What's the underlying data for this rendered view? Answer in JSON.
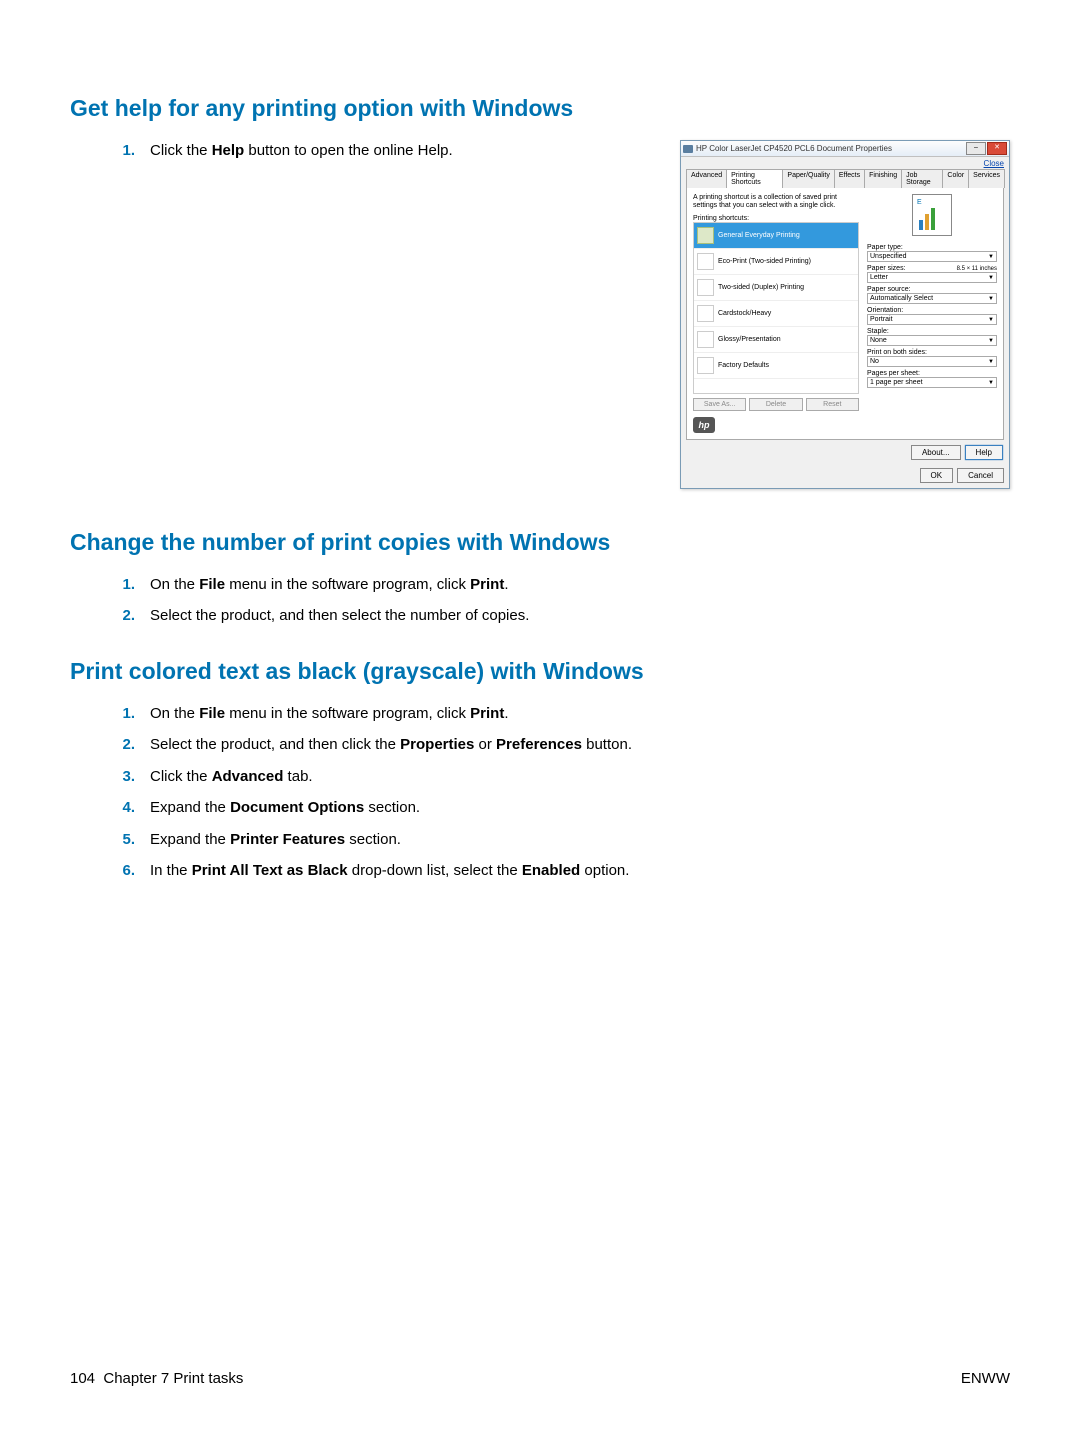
{
  "headings": {
    "h1": "Get help for any printing option with Windows",
    "h2": "Change the number of print copies with Windows",
    "h3": "Print colored text as black (grayscale) with Windows"
  },
  "section1": {
    "step1_num": "1.",
    "step1_a": "Click the ",
    "step1_b": "Help",
    "step1_c": " button to open the online Help."
  },
  "section2": {
    "step1_num": "1.",
    "step1_a": "On the ",
    "step1_b": "File",
    "step1_c": " menu in the software program, click ",
    "step1_d": "Print",
    "step1_e": ".",
    "step2_num": "2.",
    "step2": "Select the product, and then select the number of copies."
  },
  "section3": {
    "s1_num": "1.",
    "s1_a": "On the ",
    "s1_b": "File",
    "s1_c": " menu in the software program, click ",
    "s1_d": "Print",
    "s1_e": ".",
    "s2_num": "2.",
    "s2_a": "Select the product, and then click the ",
    "s2_b": "Properties",
    "s2_c": " or ",
    "s2_d": "Preferences",
    "s2_e": " button.",
    "s3_num": "3.",
    "s3_a": "Click the ",
    "s3_b": "Advanced",
    "s3_c": " tab.",
    "s4_num": "4.",
    "s4_a": "Expand the ",
    "s4_b": "Document Options",
    "s4_c": " section.",
    "s5_num": "5.",
    "s5_a": "Expand the ",
    "s5_b": "Printer Features",
    "s5_c": " section.",
    "s6_num": "6.",
    "s6_a": "In the ",
    "s6_b": "Print All Text as Black",
    "s6_c": " drop-down list, select the ",
    "s6_d": "Enabled",
    "s6_e": " option."
  },
  "footer": {
    "left_page": "104",
    "left_chapter": "Chapter 7   Print tasks",
    "right": "ENWW"
  },
  "dialog": {
    "title": "HP Color LaserJet CP4520 PCL6 Document Properties",
    "close_link": "Close",
    "tabs": [
      "Advanced",
      "Printing Shortcuts",
      "Paper/Quality",
      "Effects",
      "Finishing",
      "Job Storage",
      "Color",
      "Services"
    ],
    "desc": "A printing shortcut is a collection of saved print settings that you can select with a single click.",
    "list_label": "Printing shortcuts:",
    "shortcuts": [
      "General Everyday Printing",
      "Eco-Print (Two-sided Printing)",
      "Two-sided (Duplex) Printing",
      "Cardstock/Heavy",
      "Glossy/Presentation",
      "Factory Defaults"
    ],
    "sbtns": [
      "Save As...",
      "Delete",
      "Reset"
    ],
    "fields": {
      "paper_type_l": "Paper type:",
      "paper_type_v": "Unspecified",
      "paper_size_l": "Paper sizes:",
      "paper_size_note": "8.5 × 11 inches",
      "paper_size_v": "Letter",
      "paper_src_l": "Paper source:",
      "paper_src_v": "Automatically Select",
      "orient_l": "Orientation:",
      "orient_v": "Portrait",
      "staple_l": "Staple:",
      "staple_v": "None",
      "both_l": "Print on both sides:",
      "both_v": "No",
      "pps_l": "Pages per sheet:",
      "pps_v": "1 page per sheet"
    },
    "about": "About...",
    "help": "Help",
    "ok": "OK",
    "cancel": "Cancel"
  }
}
